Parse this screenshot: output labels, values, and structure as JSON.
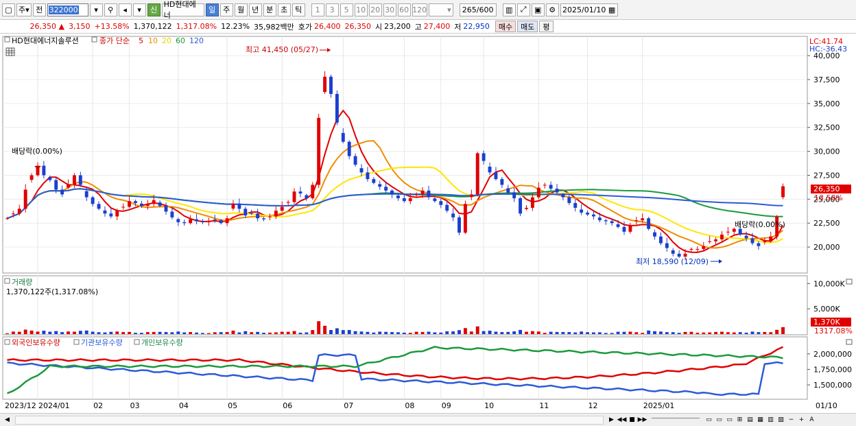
{
  "toolbar": {
    "period_select": "주",
    "prev_label": "전",
    "stock_code": "322000",
    "new_badge": "신",
    "stock_name": "HD현대에너",
    "period_buttons": [
      "일",
      "주",
      "월",
      "년",
      "분",
      "초",
      "틱"
    ],
    "active_period": "일",
    "interval_buttons": [
      "1",
      "3",
      "5",
      "10",
      "20",
      "30",
      "60",
      "120"
    ],
    "count_value": "265",
    "count_total": "/600",
    "date_value": "2025/01/10"
  },
  "quote": {
    "price": "26,350 ▲",
    "change": "3,150",
    "change_pct": "+13.58%",
    "volume": "1,370,122",
    "volume_pct": "1,317.08%",
    "turnover": "12.23%",
    "amount": "35,982백만",
    "bid_ask_label": "호가",
    "ask": "26,400",
    "bid": "26,350",
    "open_label": "시",
    "open": "23,200",
    "high_label": "고",
    "high": "27,400",
    "low_label": "저",
    "low": "22,950",
    "buy_label": "매수",
    "sell_label": "매도",
    "eval_label": "평"
  },
  "price_panel": {
    "title": "HD현대에너지솔루션",
    "ma_label": "종가 단순",
    "ma_periods": [
      "5",
      "10",
      "20",
      "60",
      "120"
    ],
    "lc": "LC:41.74",
    "hc": "HC:-36.43",
    "high_marker": "최고 41,450 (05/27)",
    "low_marker": "최저 18,590 (12/09)",
    "dividend_marker_1": "배당락(0.00%)",
    "dividend_marker_2": "배당락(0.00%)",
    "price_tag": "26,350",
    "pct_tag": "13.58%"
  },
  "volume_panel": {
    "title": "거래량",
    "value": "1,370,122주(1,317.08%)",
    "tag": "1,370K",
    "tag_pct": "1317.08%"
  },
  "holdings_panel": {
    "labels": [
      "외국인보유수량",
      "기관보유수량",
      "개인보유수량"
    ]
  },
  "colors": {
    "up": "#e00000",
    "down": "#1a3fd0",
    "ma5": "#e00000",
    "ma10": "#f08c00",
    "ma20": "#ffe600",
    "ma60": "#1a9a3a",
    "ma120": "#2b5ad8"
  },
  "chart_data": [
    {
      "type": "candlestick",
      "title": "HD현대에너지솔루션",
      "x_labels": [
        "2023/12",
        "2024/01",
        "02",
        "03",
        "04",
        "05",
        "06",
        "07",
        "08",
        "09",
        "10",
        "11",
        "12",
        "2025/01",
        "01/10"
      ],
      "y_ticks": [
        "40,000",
        "37,500",
        "35,000",
        "32,500",
        "30,000",
        "27,500",
        "25,000",
        "22,500",
        "20,000"
      ],
      "ylim": [
        17500,
        41800
      ],
      "close": [
        23000,
        23500,
        24000,
        26000,
        27500,
        28500,
        27500,
        27000,
        26000,
        25500,
        26500,
        27500,
        26500,
        25200,
        24500,
        24000,
        23500,
        23200,
        23800,
        24200,
        24800,
        24600,
        24300,
        24500,
        24900,
        24300,
        23700,
        23100,
        22600,
        22500,
        22900,
        22700,
        22600,
        22700,
        22800,
        22500,
        23000,
        24500,
        24000,
        23300,
        23500,
        23000,
        22900,
        23200,
        23800,
        24200,
        24700,
        25800,
        25600,
        25100,
        26500,
        33500,
        37800,
        36000,
        33000,
        31000,
        29500,
        28600,
        27800,
        27100,
        26700,
        26300,
        25900,
        25500,
        25100,
        24800,
        25100,
        25500,
        25900,
        25200,
        24800,
        24400,
        23800,
        23100,
        21500,
        24500,
        25500,
        29800,
        29000,
        27800,
        27100,
        26500,
        25700,
        25100,
        23500,
        24100,
        25200,
        26200,
        26500,
        26100,
        25700,
        25200,
        24600,
        24100,
        23600,
        23400,
        23200,
        22800,
        22700,
        22500,
        22100,
        21600,
        22300,
        22800,
        23000,
        21900,
        21100,
        20400,
        19900,
        19300,
        19000,
        19300,
        19800,
        19800,
        20100,
        20600,
        20800,
        21300,
        21600,
        21900,
        21300,
        20900,
        20400,
        20100,
        20600,
        21100,
        23200,
        26350
      ],
      "ma": {
        "periods": [
          5,
          10,
          20,
          60,
          120
        ]
      }
    },
    {
      "type": "bar",
      "title": "거래량",
      "y_ticks": [
        "10,000K",
        "5,000K"
      ],
      "ylim": [
        0,
        11000000
      ],
      "last_value": 1370122
    },
    {
      "type": "line",
      "series_names": [
        "외국인보유수량",
        "기관보유수량",
        "개인보유수량"
      ],
      "y_ticks": [
        "2,000,000",
        "1,750,000",
        "1,500,000"
      ],
      "ylim": [
        1280000,
        2230000
      ]
    }
  ],
  "bottom": {
    "nav_buttons": [
      "▶",
      "◀◀",
      "■",
      "▶▶"
    ],
    "zoom_buttons": [
      "−",
      "+",
      "A"
    ]
  }
}
